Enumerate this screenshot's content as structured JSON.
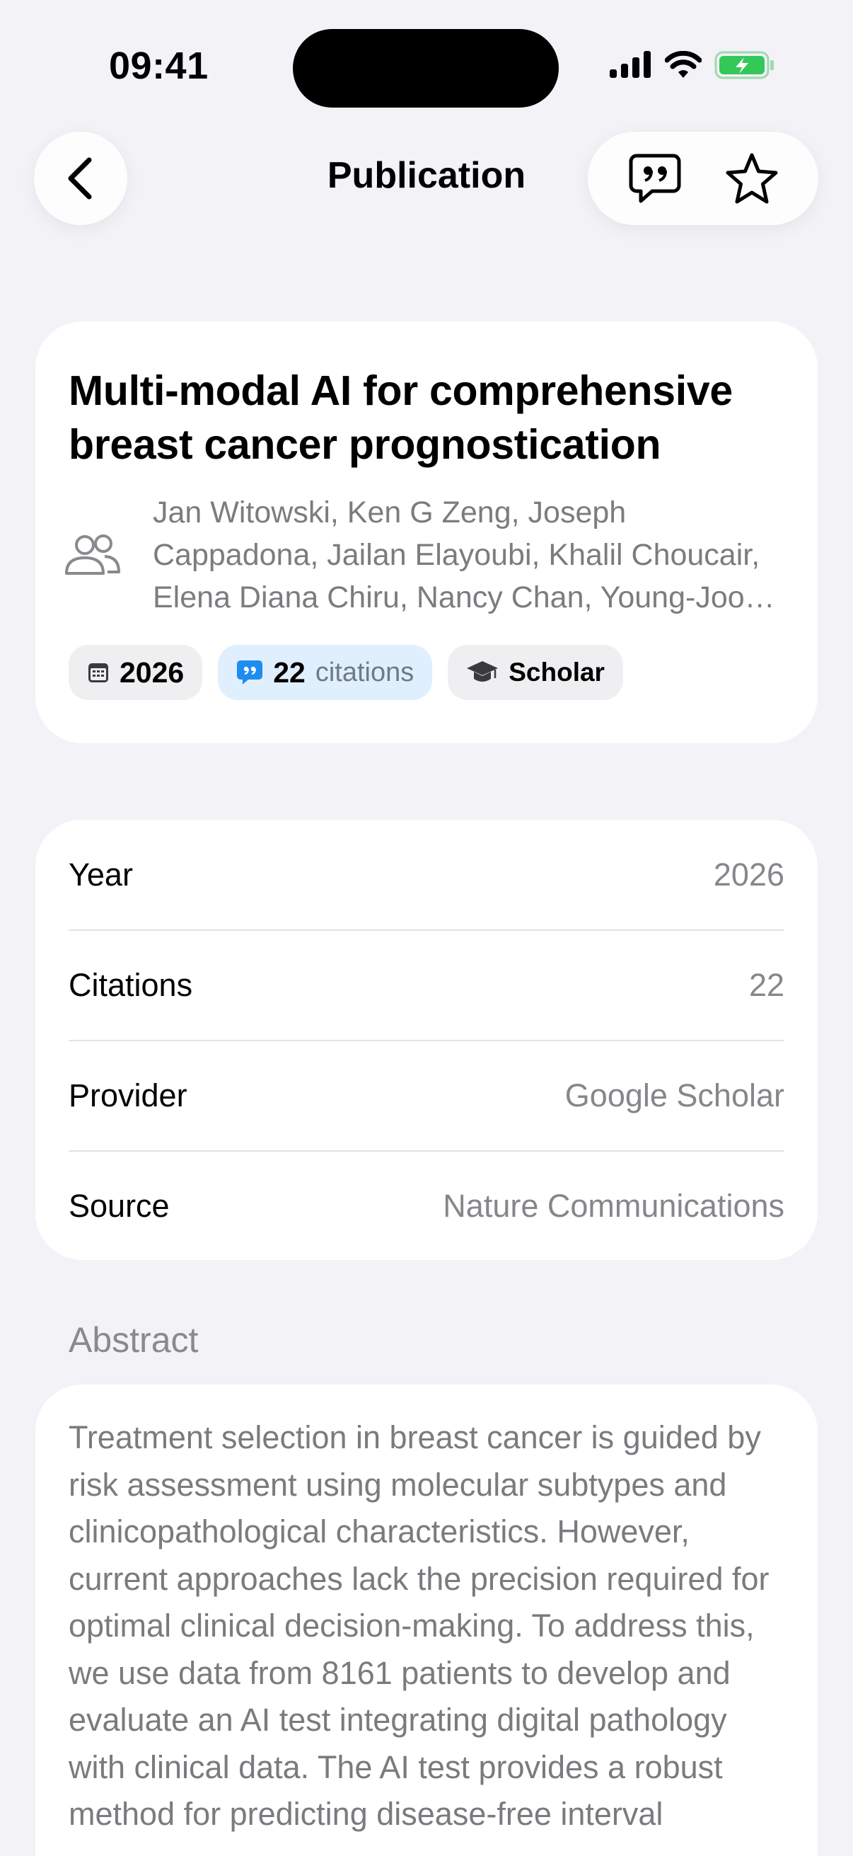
{
  "status_bar": {
    "time": "09:41"
  },
  "nav": {
    "title": "Publication"
  },
  "publication": {
    "title": "Multi-modal AI for comprehensive breast cancer prognostication",
    "authors": "Jan Witowski, Ken G Zeng, Joseph Cappadona, Jailan Elayoubi, Khalil Choucair, Elena Diana Chiru, Nancy Chan, Young-Joon Kang, Frederick Howard, Irina Ostrovnaya",
    "chips": {
      "year": "2026",
      "citations_count": "22",
      "citations_label": "citations",
      "provider_short": "Scholar"
    }
  },
  "details": [
    {
      "label": "Year",
      "value": "2026"
    },
    {
      "label": "Citations",
      "value": "22"
    },
    {
      "label": "Provider",
      "value": "Google Scholar"
    },
    {
      "label": "Source",
      "value": "Nature Communications"
    }
  ],
  "abstract": {
    "heading": "Abstract",
    "text": "Treatment selection in breast cancer is guided by risk assessment using molecular subtypes and clinicopathological characteristics. However, current approaches lack the precision required for optimal clinical decision-making. To address this, we use data from 8161 patients to develop and evaluate an AI test integrating digital pathology with clinical data. The AI test provides a robust method for predicting disease-free interval"
  },
  "colors": {
    "background": "#f2f2f7",
    "card": "#ffffff",
    "secondary_text": "#86868b",
    "accent_blue": "#1f8cf0",
    "battery_green": "#34c759"
  },
  "icons": [
    "back-chevron-icon",
    "quote-bubble-icon",
    "star-icon",
    "people-icon",
    "calendar-icon",
    "graduation-cap-icon",
    "signal-icon",
    "wifi-icon",
    "battery-icon"
  ]
}
